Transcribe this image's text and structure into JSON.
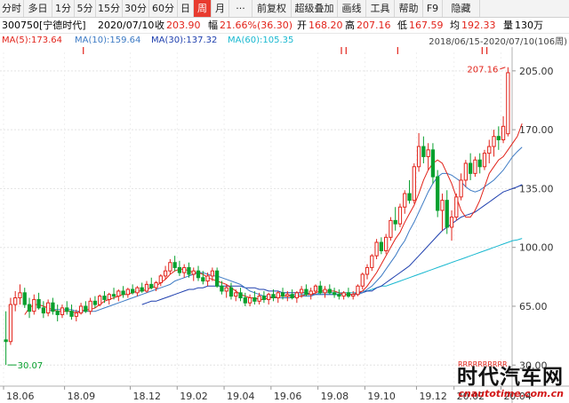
{
  "toolbar": {
    "items": [
      "分时",
      "多日",
      "1分",
      "5分",
      "15分",
      "30分",
      "60分",
      "日",
      "周",
      "月",
      "···",
      "前复权",
      "超级叠加",
      "画线",
      "工具",
      "帮助",
      "F9",
      "隐藏"
    ],
    "active_index": 8
  },
  "quote": {
    "code": "300750[宁德时代]",
    "date": "2020/07/10",
    "close_label": "收",
    "close": "203.90",
    "change_label": "幅",
    "change": "21.66%(36.30)",
    "open_label": "开",
    "open": "168.20",
    "high_label": "高",
    "high": "207.16",
    "low_label": "低",
    "low": "167.59",
    "avg_label": "均",
    "avg": "192.33",
    "volume_label": "量",
    "volume": "130万"
  },
  "ma": [
    {
      "label": "MA(5):173.64",
      "color": "#e2231a"
    },
    {
      "label": "MA(10):159.64",
      "color": "#3c7ac4"
    },
    {
      "label": "MA(30):137.32",
      "color": "#1e3fae"
    },
    {
      "label": "MA(60):105.35",
      "color": "#18b8d0"
    }
  ],
  "range_text": "2018/06/15-2020/07/10(106周)",
  "watermark": {
    "title": "时代汽车网",
    "url": "cnautotime.com.cn"
  },
  "rrr_text": "RRRRRRRRRR",
  "chart_data": {
    "type": "candlestick",
    "y_ticks": [
      30.0,
      65.0,
      100.0,
      135.0,
      170.0,
      205.0
    ],
    "y_tick_labels": [
      "30.00",
      "65.00",
      "100.00",
      "135.00",
      "170.00",
      "205.00"
    ],
    "ylim": [
      18,
      216
    ],
    "x_labels": [
      "18.06",
      "18.09",
      "18.12",
      "19.02",
      "19.04",
      "19.06",
      "19.08",
      "19.10",
      "19.12",
      "20.02",
      "20.04"
    ],
    "x_label_index": [
      0,
      13,
      27,
      37,
      47,
      57,
      67,
      77,
      88,
      96,
      106
    ],
    "high_annotation": "207.16",
    "low_annotation": "30.07",
    "candles": [
      [
        45,
        62,
        30.07,
        44
      ],
      [
        44,
        70,
        42,
        66
      ],
      [
        66,
        74,
        62,
        70
      ],
      [
        70,
        78,
        66,
        73
      ],
      [
        73,
        76,
        64,
        66
      ],
      [
        66,
        70,
        58,
        62
      ],
      [
        62,
        72,
        60,
        69
      ],
      [
        69,
        73,
        63,
        64
      ],
      [
        64,
        68,
        58,
        61
      ],
      [
        61,
        69,
        59,
        67
      ],
      [
        67,
        70,
        60,
        62
      ],
      [
        62,
        66,
        56,
        60
      ],
      [
        60,
        66,
        58,
        64
      ],
      [
        64,
        68,
        60,
        62
      ],
      [
        62,
        66,
        57,
        59
      ],
      [
        59,
        63,
        56,
        61
      ],
      [
        61,
        67,
        60,
        65
      ],
      [
        65,
        68,
        61,
        62
      ],
      [
        62,
        70,
        60,
        68
      ],
      [
        68,
        71,
        64,
        66
      ],
      [
        66,
        72,
        65,
        71
      ],
      [
        71,
        74,
        67,
        69
      ],
      [
        69,
        73,
        66,
        72
      ],
      [
        72,
        76,
        69,
        71
      ],
      [
        71,
        75,
        68,
        74
      ],
      [
        74,
        77,
        70,
        72
      ],
      [
        72,
        76,
        70,
        75
      ],
      [
        75,
        78,
        72,
        73
      ],
      [
        73,
        77,
        71,
        76
      ],
      [
        76,
        79,
        73,
        74
      ],
      [
        74,
        80,
        73,
        78
      ],
      [
        78,
        82,
        75,
        76
      ],
      [
        76,
        80,
        74,
        79
      ],
      [
        79,
        84,
        77,
        83
      ],
      [
        83,
        89,
        81,
        86
      ],
      [
        86,
        93,
        84,
        91
      ],
      [
        91,
        95,
        86,
        88
      ],
      [
        88,
        92,
        83,
        85
      ],
      [
        85,
        90,
        82,
        88
      ],
      [
        88,
        91,
        82,
        84
      ],
      [
        84,
        88,
        80,
        86
      ],
      [
        86,
        89,
        80,
        82
      ],
      [
        82,
        86,
        78,
        80
      ],
      [
        80,
        85,
        77,
        83
      ],
      [
        83,
        88,
        80,
        86
      ],
      [
        86,
        88,
        76,
        77
      ],
      [
        77,
        80,
        72,
        74
      ],
      [
        74,
        78,
        70,
        76
      ],
      [
        76,
        79,
        69,
        71
      ],
      [
        71,
        75,
        68,
        73
      ],
      [
        73,
        76,
        68,
        70
      ],
      [
        70,
        73,
        65,
        67
      ],
      [
        67,
        72,
        65,
        70
      ],
      [
        70,
        74,
        66,
        68
      ],
      [
        68,
        73,
        66,
        71
      ],
      [
        71,
        74,
        67,
        69
      ],
      [
        69,
        73,
        66,
        72
      ],
      [
        72,
        75,
        68,
        70
      ],
      [
        70,
        74,
        67,
        73
      ],
      [
        73,
        76,
        69,
        71
      ],
      [
        71,
        74,
        68,
        72
      ],
      [
        72,
        75,
        69,
        70
      ],
      [
        70,
        74,
        67,
        73
      ],
      [
        73,
        77,
        70,
        75
      ],
      [
        75,
        78,
        71,
        72
      ],
      [
        72,
        76,
        69,
        74
      ],
      [
        74,
        78,
        72,
        77
      ],
      [
        77,
        80,
        72,
        73
      ],
      [
        73,
        77,
        70,
        75
      ],
      [
        75,
        78,
        72,
        73
      ],
      [
        73,
        76,
        70,
        72
      ],
      [
        72,
        75,
        69,
        71
      ],
      [
        71,
        74,
        69,
        73
      ],
      [
        73,
        76,
        70,
        71
      ],
      [
        71,
        74,
        69,
        72
      ],
      [
        72,
        78,
        71,
        77
      ],
      [
        77,
        85,
        75,
        84
      ],
      [
        84,
        90,
        81,
        88
      ],
      [
        88,
        96,
        86,
        95
      ],
      [
        95,
        105,
        93,
        103
      ],
      [
        103,
        106,
        96,
        98
      ],
      [
        98,
        108,
        96,
        106
      ],
      [
        106,
        118,
        104,
        116
      ],
      [
        116,
        124,
        110,
        114
      ],
      [
        114,
        126,
        112,
        124
      ],
      [
        124,
        134,
        120,
        132
      ],
      [
        132,
        140,
        126,
        128
      ],
      [
        128,
        150,
        126,
        148
      ],
      [
        148,
        168,
        145,
        160
      ],
      [
        160,
        166,
        150,
        154
      ],
      [
        154,
        162,
        146,
        158
      ],
      [
        158,
        162,
        138,
        142
      ],
      [
        142,
        146,
        118,
        122
      ],
      [
        122,
        132,
        110,
        128
      ],
      [
        128,
        134,
        108,
        112
      ],
      [
        112,
        122,
        104,
        118
      ],
      [
        118,
        132,
        116,
        130
      ],
      [
        130,
        144,
        128,
        140
      ],
      [
        140,
        152,
        136,
        150
      ],
      [
        150,
        156,
        140,
        144
      ],
      [
        144,
        154,
        142,
        152
      ],
      [
        152,
        156,
        144,
        148
      ],
      [
        148,
        158,
        146,
        156
      ],
      [
        156,
        164,
        150,
        160
      ],
      [
        160,
        170,
        154,
        166
      ],
      [
        166,
        172,
        158,
        164
      ],
      [
        164,
        178,
        162,
        172
      ],
      [
        167.59,
        207.16,
        166,
        203.9
      ]
    ],
    "ma5": [
      null,
      null,
      null,
      null,
      60,
      64,
      66,
      66,
      65,
      64,
      63,
      62,
      62,
      62,
      62,
      61,
      62,
      63,
      63,
      64,
      66,
      68,
      69,
      70,
      71,
      72,
      72,
      73,
      74,
      74,
      75,
      76,
      77,
      79,
      81,
      84,
      86,
      87,
      87,
      86,
      85,
      85,
      84,
      82,
      81,
      80,
      79,
      78,
      76,
      74,
      72,
      71,
      70,
      70,
      69,
      69,
      70,
      70,
      71,
      71,
      71,
      71,
      71,
      71,
      72,
      72,
      73,
      74,
      74,
      74,
      74,
      73,
      72,
      72,
      72,
      73,
      74,
      77,
      81,
      85,
      90,
      95,
      100,
      105,
      109,
      115,
      120,
      125,
      132,
      140,
      146,
      150,
      152,
      150,
      144,
      138,
      130,
      122,
      118,
      118,
      122,
      128,
      136,
      144,
      148,
      152,
      154,
      158,
      162,
      166,
      173.64
    ],
    "ma10": [
      null,
      null,
      null,
      null,
      null,
      null,
      null,
      null,
      null,
      62,
      63,
      63,
      63,
      63,
      63,
      62,
      62,
      62,
      62,
      62,
      63,
      64,
      65,
      66,
      67,
      68,
      69,
      70,
      71,
      72,
      73,
      74,
      75,
      76,
      77,
      78,
      80,
      81,
      82,
      83,
      84,
      85,
      85,
      84,
      83,
      83,
      82,
      81,
      80,
      79,
      78,
      76,
      74,
      73,
      72,
      71,
      71,
      70,
      70,
      70,
      70,
      70,
      71,
      71,
      71,
      71,
      72,
      72,
      72,
      72,
      72,
      72,
      72,
      72,
      72,
      72,
      73,
      75,
      77,
      80,
      83,
      87,
      91,
      95,
      100,
      104,
      110,
      115,
      121,
      127,
      133,
      138,
      142,
      144,
      144,
      143,
      141,
      139,
      136,
      134,
      133,
      134,
      136,
      138,
      140,
      143,
      146,
      150,
      154,
      157,
      159.64
    ],
    "ma30": [
      null,
      null,
      null,
      null,
      null,
      null,
      null,
      null,
      null,
      null,
      null,
      null,
      null,
      null,
      null,
      null,
      null,
      null,
      null,
      null,
      null,
      null,
      null,
      null,
      null,
      null,
      null,
      null,
      null,
      66,
      67,
      68,
      68,
      69,
      70,
      71,
      72,
      73,
      74,
      75,
      75,
      76,
      76,
      77,
      77,
      77,
      77,
      77,
      77,
      77,
      77,
      76,
      76,
      76,
      75,
      75,
      74,
      74,
      74,
      73,
      73,
      73,
      73,
      73,
      73,
      72,
      72,
      72,
      72,
      72,
      72,
      72,
      72,
      72,
      72,
      73,
      73,
      74,
      74,
      76,
      77,
      79,
      81,
      83,
      85,
      87,
      89,
      92,
      95,
      98,
      101,
      104,
      107,
      110,
      112,
      114,
      116,
      118,
      119,
      120,
      121,
      123,
      125,
      127,
      129,
      131,
      133,
      134,
      135,
      136,
      137.32
    ],
    "ma60": [
      null,
      null,
      null,
      null,
      null,
      null,
      null,
      null,
      null,
      null,
      null,
      null,
      null,
      null,
      null,
      null,
      null,
      null,
      null,
      null,
      null,
      null,
      null,
      null,
      null,
      null,
      null,
      null,
      null,
      null,
      null,
      null,
      null,
      null,
      null,
      null,
      null,
      null,
      null,
      null,
      null,
      null,
      null,
      null,
      null,
      null,
      null,
      null,
      null,
      null,
      null,
      null,
      null,
      null,
      null,
      null,
      null,
      null,
      null,
      71,
      71,
      72,
      72,
      72,
      72,
      72,
      72,
      73,
      73,
      73,
      73,
      73,
      73,
      73,
      73,
      73,
      74,
      74,
      75,
      76,
      77,
      77,
      78,
      79,
      80,
      81,
      82,
      83,
      84,
      85,
      86,
      87,
      88,
      89,
      90,
      91,
      92,
      93,
      94,
      95,
      96,
      97,
      98,
      99,
      100,
      101,
      102,
      103,
      104,
      104.5,
      105.35
    ]
  }
}
